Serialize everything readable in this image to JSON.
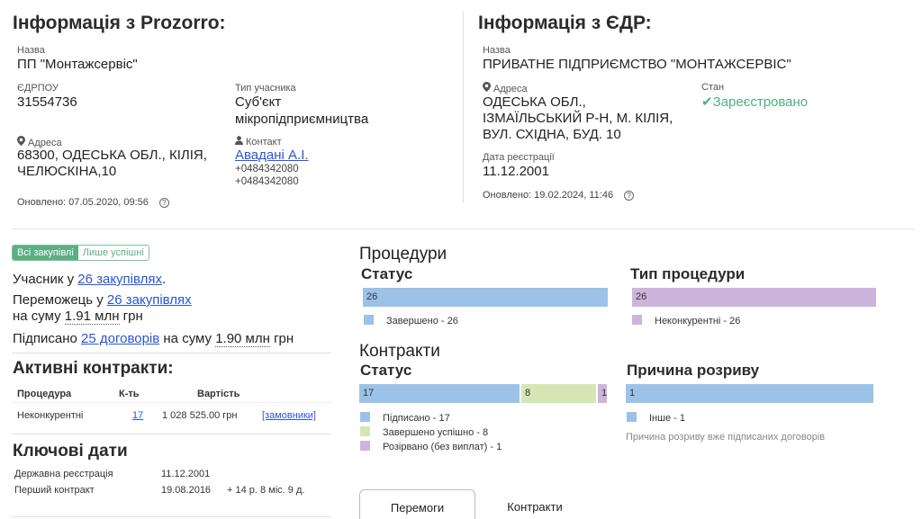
{
  "prozorro": {
    "title": "Інформація з Prozorro:",
    "name_label": "Назва",
    "name": "ПП \"Монтажсервіс\"",
    "edrpou_label": "ЄДРПОУ",
    "edrpou": "31554736",
    "type_label": "Тип учасника",
    "type_line1": "Суб'єкт",
    "type_line2": "мікропідприємництва",
    "address_label": "Адреса",
    "address_line1": "68300, ОДЕСЬКА ОБЛ., КІЛІЯ,",
    "address_line2": "ЧЕЛЮСКІНА,10",
    "contact_label": "Контакт",
    "contact_name": "Авадані А.І.",
    "phone1": "+0484342080",
    "phone2": "+0484342080",
    "updated": "Оновлено: 07.05.2020, 09:56"
  },
  "edr": {
    "title": "Інформація з ЄДР:",
    "name_label": "Назва",
    "name": "ПРИВАТНЕ ПІДПРИЄМСТВО \"МОНТАЖСЕРВІС\"",
    "address_label": "Адреса",
    "address_line1": "ОДЕСЬКА ОБЛ.,",
    "address_line2": "ІЗМАЇЛЬСЬКИЙ Р-Н, М. КІЛІЯ,",
    "address_line3": "ВУЛ. СХІДНА, БУД. 10",
    "state_label": "Стан",
    "state": "Зареєстровано",
    "reg_label": "Дата реєстрації",
    "reg_date": "11.12.2001",
    "updated": "Оновлено: 19.02.2024, 11:46"
  },
  "filter": {
    "all": "Всі закупівлі",
    "success": "Лише успішні"
  },
  "summary": {
    "participant_prefix": "Учасник у ",
    "participant_link": "26 закупівлях",
    "participant_suffix": ".",
    "winner_prefix": "Переможець у ",
    "winner_link": "26 закупівлях",
    "winner_sum_prefix": "на суму ",
    "winner_sum": "1.91 млн",
    "winner_currency": " грн",
    "signed_prefix": "Підписано ",
    "signed_link": "25 договорів",
    "signed_mid": " на суму ",
    "signed_sum": "1.90 млн",
    "signed_currency": " грн"
  },
  "active_contracts": {
    "title": "Активні контракти:",
    "headers": [
      "Процедура",
      "К-ть",
      "Вартість"
    ],
    "row": {
      "procedure": "Неконкурентні",
      "count": "17",
      "value": "1 028 525.00 грн",
      "link": "[замовники]"
    }
  },
  "key_dates": {
    "title": "Ключові дати",
    "reg_label": "Державна реєстрація",
    "reg_value": "11.12.2001",
    "first_label": "Перший контракт",
    "first_value": "19.08.2016",
    "first_since": "+ 14 р. 8 міс. 9 д."
  },
  "procedures": {
    "title": "Процедури",
    "status_title": "Статус",
    "type_title": "Тип процедури",
    "status_bar": [
      {
        "label": "26",
        "value": 26,
        "color": "#9cc2e8"
      }
    ],
    "status_legend": [
      {
        "label": "Завершено - 26",
        "color": "#9cc2e8"
      }
    ],
    "type_bar": [
      {
        "label": "26",
        "value": 26,
        "color": "#cdb4dc"
      }
    ],
    "type_legend": [
      {
        "label": "Неконкурентні - 26",
        "color": "#cdb4dc"
      }
    ]
  },
  "contracts": {
    "title": "Контракти",
    "status_title": "Статус",
    "reason_title": "Причина розриву",
    "status_bar": [
      {
        "label": "17",
        "value": 17,
        "color": "#9cc2e8"
      },
      {
        "label": "8",
        "value": 8,
        "color": "#d5e6b4"
      },
      {
        "label": "1",
        "value": 1,
        "color": "#cdb4dc"
      }
    ],
    "status_legend": [
      {
        "label": "Підписано - 17",
        "color": "#9cc2e8"
      },
      {
        "label": "Завершено успішно - 8",
        "color": "#d5e6b4"
      },
      {
        "label": "Розірвано (без виплат) - 1",
        "color": "#cdb4dc"
      }
    ],
    "reason_bar": [
      {
        "label": "1",
        "value": 1,
        "color": "#9cc2e8"
      }
    ],
    "reason_legend": [
      {
        "label": "Інше - 1",
        "color": "#9cc2e8"
      }
    ],
    "reason_note": "Причина розриву вже підписаних договорів"
  },
  "tabs": [
    "Перемоги",
    "Контракти"
  ]
}
